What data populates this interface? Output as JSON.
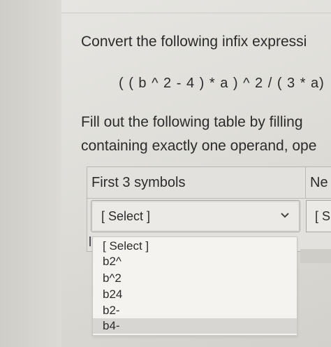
{
  "question": {
    "prompt": "Convert the following infix expressi",
    "expression": "( ( b ^ 2 - 4 ) * a ) ^ 2  / ( 3 * a)",
    "instructions_line1": "Fill out the following table by filling",
    "instructions_line2": "containing exactly one operand, ope"
  },
  "table": {
    "headers": [
      "First 3 symbols",
      "Ne"
    ]
  },
  "select": {
    "selected": "[ Select ]",
    "next_selected": "[ S",
    "options": [
      "[ Select ]",
      "b2^",
      "b^2",
      "b24",
      "b2-",
      "b4-"
    ],
    "highlighted_index": 5
  },
  "colors": {
    "background": "#dfded9",
    "text": "#2b2b2b",
    "highlight": "#d7d6d2"
  }
}
